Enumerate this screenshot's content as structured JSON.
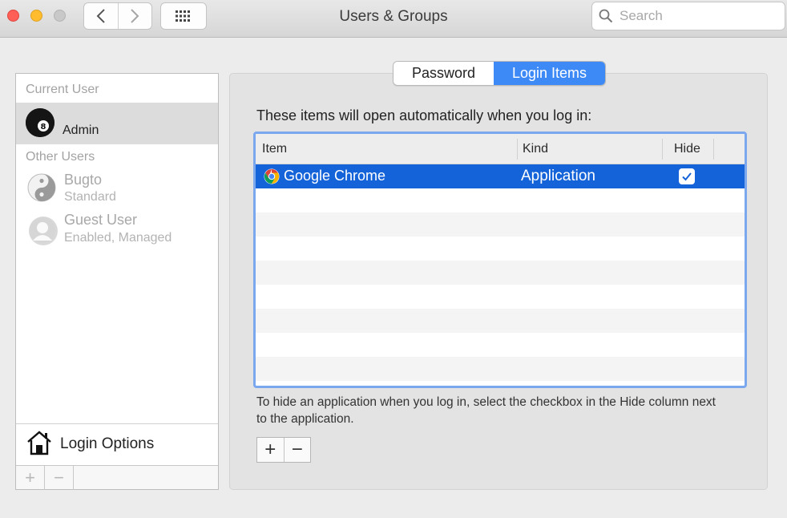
{
  "window": {
    "title": "Users & Groups",
    "search_placeholder": "Search"
  },
  "sidebar": {
    "current_user_header": "Current User",
    "current_user": {
      "name": "Admin"
    },
    "other_users_header": "Other Users",
    "other_users": [
      {
        "name": "Bugto",
        "role": "Standard"
      },
      {
        "name": "Guest User",
        "role": "Enabled, Managed"
      }
    ],
    "login_options_label": "Login Options",
    "add_label": "+",
    "remove_label": "−"
  },
  "tabs": [
    {
      "label": "Password",
      "selected": false
    },
    {
      "label": "Login Items",
      "selected": true
    }
  ],
  "login_items": {
    "intro": "These items will open automatically when you log in:",
    "columns": [
      "Item",
      "Kind",
      "Hide"
    ],
    "rows": [
      {
        "item": "Google Chrome",
        "kind": "Application",
        "hide": true
      }
    ],
    "help_text": "To hide an application when you log in, select the checkbox in the Hide column next to the application.",
    "add_label": "+",
    "remove_label": "−"
  },
  "colors": {
    "accent": "#3d8af7",
    "selection": "#1463d8",
    "focus_ring": "#7aa7ee"
  }
}
